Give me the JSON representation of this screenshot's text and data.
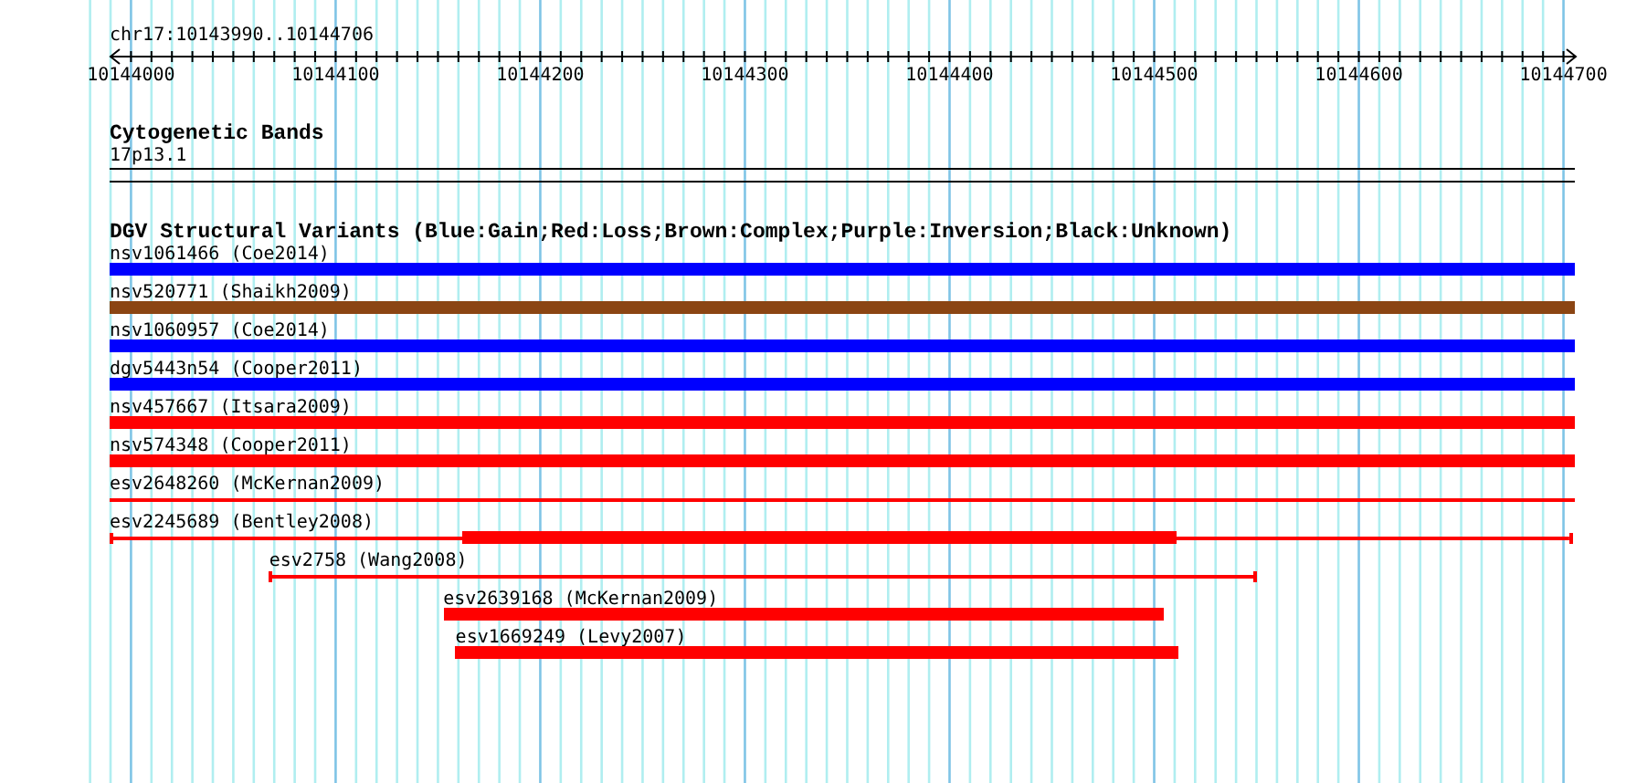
{
  "ruler": {
    "label": "chr17:10143990..10144706",
    "xticks": [
      "10144000",
      "10144100",
      "10144200",
      "10144300",
      "10144400",
      "10144500",
      "10144600",
      "10144700"
    ]
  },
  "cytogenetic": {
    "title": "Cytogenetic Bands",
    "band": "17p13.1"
  },
  "dgv": {
    "title": "DGV Structural Variants (Blue:Gain;Red:Loss;Brown:Complex;Purple:Inversion;Black:Unknown)",
    "variants": [
      {
        "label": "nsv1061466 (Coe2014)",
        "kind": "block",
        "color": "#0000ff"
      },
      {
        "label": "nsv520771 (Shaikh2009)",
        "kind": "block",
        "color": "#8b4513"
      },
      {
        "label": "nsv1060957 (Coe2014)",
        "kind": "block",
        "color": "#0000ff"
      },
      {
        "label": "dgv5443n54 (Cooper2011)",
        "kind": "block",
        "color": "#0000ff"
      },
      {
        "label": "nsv457667 (Itsara2009)",
        "kind": "block",
        "color": "#ff0000"
      },
      {
        "label": "nsv574348 (Cooper2011)",
        "kind": "block",
        "color": "#ff0000"
      },
      {
        "label": "esv2648260 (McKernan2009)",
        "kind": "line",
        "color": "#ff0000",
        "caps": false
      },
      {
        "label": "esv2245689 (Bentley2008)",
        "kind": "line",
        "color": "#ff0000",
        "caps": true
      },
      {
        "label": "esv2758 (Wang2008)",
        "kind": "line",
        "color": "#ff0000",
        "caps": true
      },
      {
        "label": "esv2639168 (McKernan2009)",
        "kind": "block",
        "color": "#ff0000"
      },
      {
        "label": "esv1669249 (Levy2007)",
        "kind": "block",
        "color": "#ff0000"
      }
    ]
  }
}
